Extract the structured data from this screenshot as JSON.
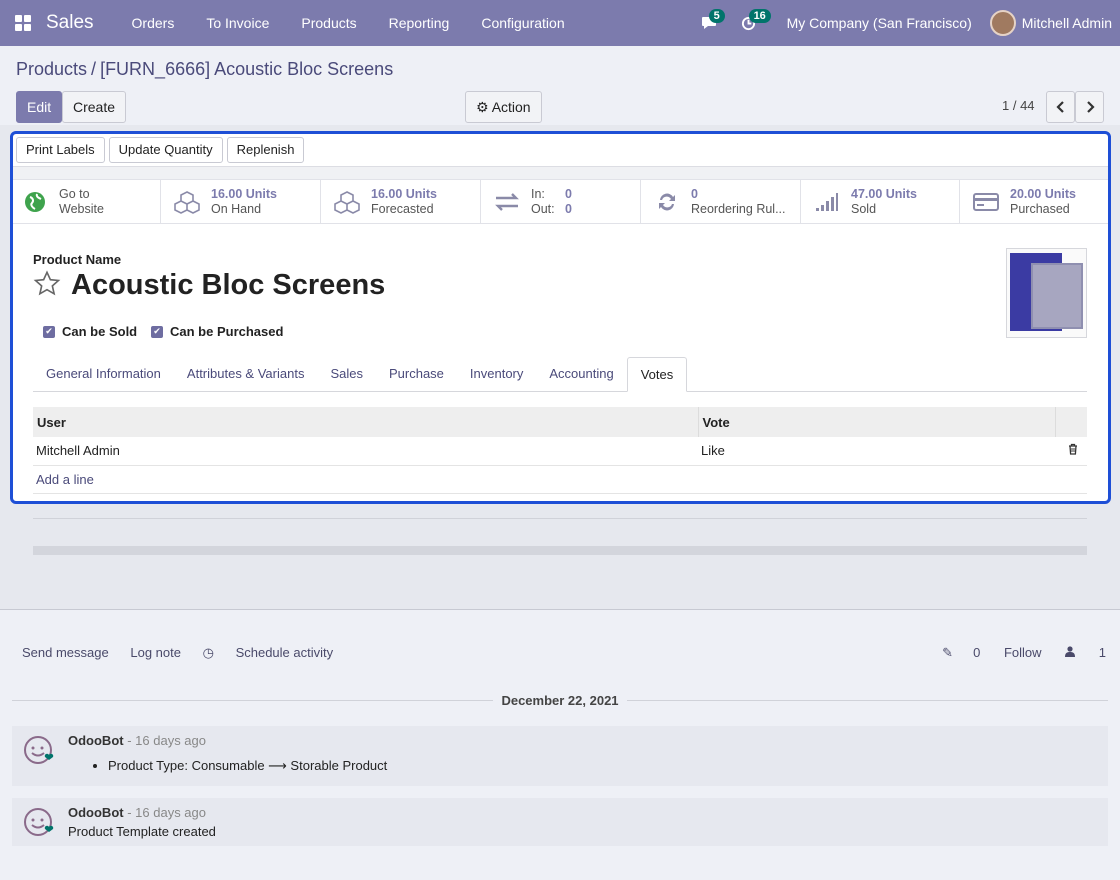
{
  "navbar": {
    "app_name": "Sales",
    "menu": [
      "Orders",
      "To Invoice",
      "Products",
      "Reporting",
      "Configuration"
    ],
    "messages_count": "5",
    "activities_count": "16",
    "company": "My Company (San Francisco)",
    "user": "Mitchell Admin"
  },
  "breadcrumb": {
    "parent": "Products",
    "separator": "/",
    "current": "[FURN_6666] Acoustic Bloc Screens"
  },
  "control": {
    "edit": "Edit",
    "create": "Create",
    "action": "Action",
    "pager": "1 / 44"
  },
  "statusbar": {
    "print_labels": "Print Labels",
    "update_quantity": "Update Quantity",
    "replenish": "Replenish"
  },
  "smart_buttons": {
    "website": {
      "line1": "Go to",
      "line2": "Website"
    },
    "on_hand": {
      "value": "16.00 Units",
      "label": "On Hand"
    },
    "forecasted": {
      "value": "16.00 Units",
      "label": "Forecasted"
    },
    "in_out": {
      "in_label": "In:",
      "in_value": "0",
      "out_label": "Out:",
      "out_value": "0"
    },
    "reordering": {
      "value": "0",
      "label": "Reordering Rul..."
    },
    "sold": {
      "value": "47.00 Units",
      "label": "Sold"
    },
    "purchased": {
      "value": "20.00 Units",
      "label": "Purchased"
    }
  },
  "product": {
    "label": "Product Name",
    "name": "Acoustic Bloc Screens",
    "can_be_sold": "Can be Sold",
    "can_be_purchased": "Can be Purchased"
  },
  "tabs": [
    "General Information",
    "Attributes & Variants",
    "Sales",
    "Purchase",
    "Inventory",
    "Accounting",
    "Votes"
  ],
  "votes": {
    "col_user": "User",
    "col_vote": "Vote",
    "rows": [
      {
        "user": "Mitchell Admin",
        "vote": "Like"
      }
    ],
    "add_line": "Add a line"
  },
  "chatter": {
    "send_message": "Send message",
    "log_note": "Log note",
    "schedule_activity": "Schedule activity",
    "attachments": "0",
    "follow": "Follow",
    "followers": "1",
    "date": "December 22, 2021",
    "messages": [
      {
        "author": "OdooBot",
        "time": "- 16 days ago",
        "body": "Product Type: Consumable ⟶ Storable Product"
      },
      {
        "author": "OdooBot",
        "time": "- 16 days ago",
        "body": "Product Template created"
      }
    ]
  },
  "colors": {
    "navbar": "#7c7bad",
    "accent": "#7c7bad",
    "highlight_border": "#1e4fd6",
    "badge": "#01746b"
  }
}
